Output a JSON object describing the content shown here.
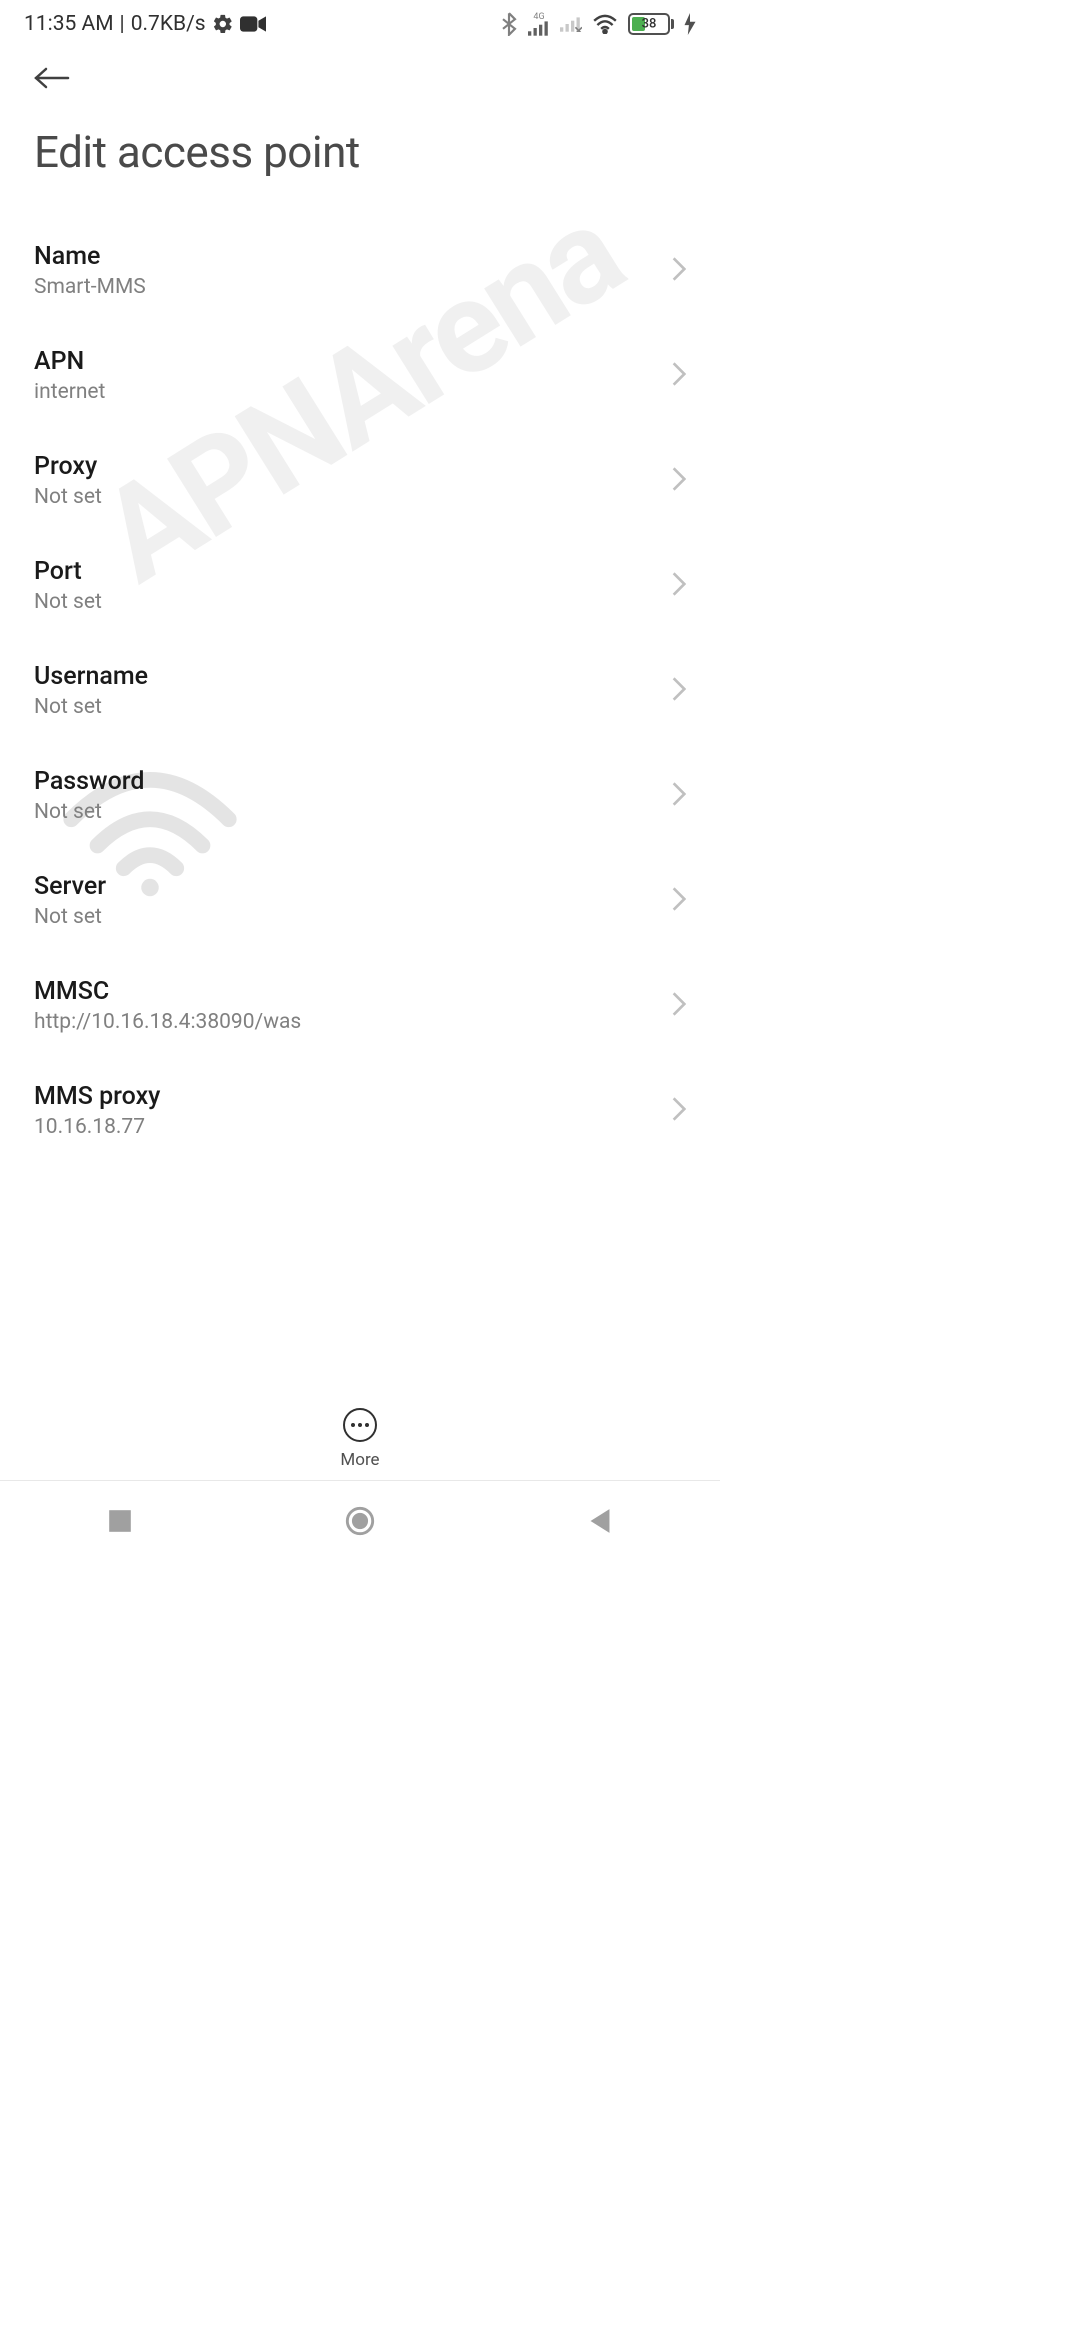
{
  "statusBar": {
    "time": "11:35 AM",
    "dataRate": "0.7KB/s",
    "networkLabel": "4G",
    "batteryPercent": "38"
  },
  "header": {
    "title": "Edit access point"
  },
  "settings": [
    {
      "label": "Name",
      "value": "Smart-MMS"
    },
    {
      "label": "APN",
      "value": "internet"
    },
    {
      "label": "Proxy",
      "value": "Not set"
    },
    {
      "label": "Port",
      "value": "Not set"
    },
    {
      "label": "Username",
      "value": "Not set"
    },
    {
      "label": "Password",
      "value": "Not set"
    },
    {
      "label": "Server",
      "value": "Not set"
    },
    {
      "label": "MMSC",
      "value": "http://10.16.18.4:38090/was"
    },
    {
      "label": "MMS proxy",
      "value": "10.16.18.77"
    }
  ],
  "bottomAction": {
    "label": "More"
  },
  "watermark": "APNArena"
}
